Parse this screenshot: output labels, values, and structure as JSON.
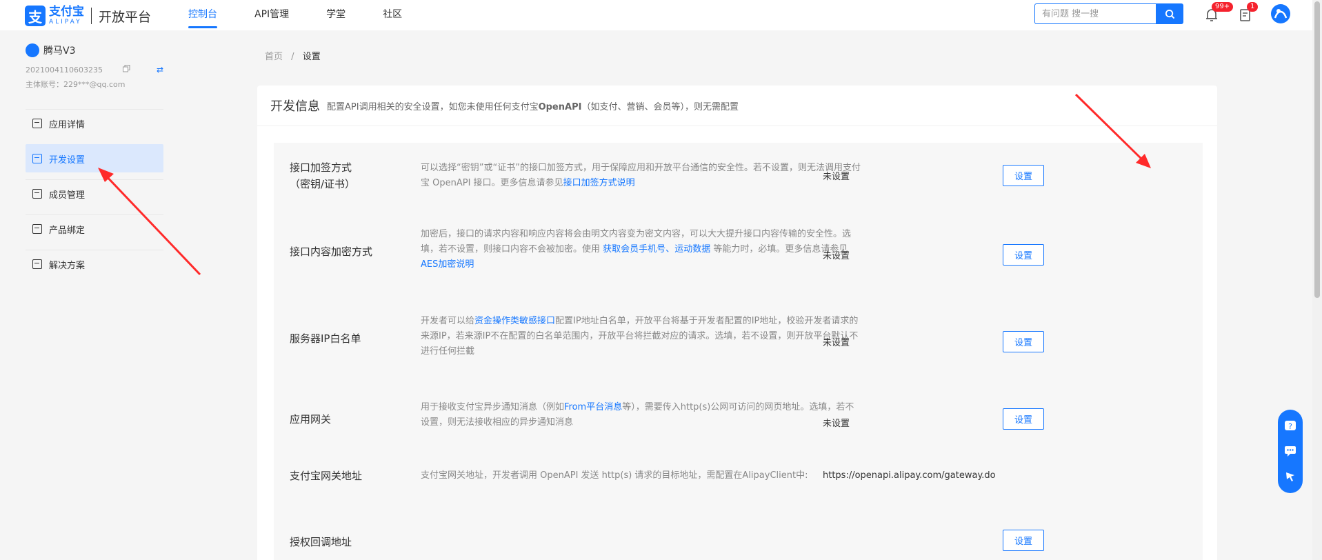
{
  "header": {
    "logo_cn": "支付宝",
    "logo_en": "ALIPAY",
    "logo_mark": "支",
    "platform": "开放平台",
    "nav": [
      {
        "label": "控制台",
        "active": true
      },
      {
        "label": "API管理",
        "active": false
      },
      {
        "label": "学堂",
        "active": false
      },
      {
        "label": "社区",
        "active": false
      }
    ],
    "search_placeholder": "有问题 搜一搜",
    "notification_badge": "99+",
    "todo_badge": "1"
  },
  "sidebar": {
    "app_name": "腾马V3",
    "app_id": "2021004110603235",
    "account": "主体账号：229***@qq.com",
    "menu": [
      {
        "label": "应用详情",
        "active": false
      },
      {
        "label": "开发设置",
        "active": true
      },
      {
        "label": "成员管理",
        "active": false
      },
      {
        "label": "产品绑定",
        "active": false
      },
      {
        "label": "解决方案",
        "active": false
      }
    ]
  },
  "breadcrumb": {
    "home": "首页",
    "separator": "/",
    "current": "设置"
  },
  "card": {
    "title": "开发信息",
    "desc_pre": "配置API调用相关的安全设置，如您未使用任何支付宝",
    "desc_bold": "OpenAPI",
    "desc_post": "（如支付、营销、会员等），则无需配置"
  },
  "rows": [
    {
      "label_line1": "接口加签方式",
      "label_line2": "（密钥/证书）",
      "desc_a": "可以选择“密钥”或“证书”的接口加签方式，用于保障应用和开放平台通信的安全性。若不设置，则无法调用支付宝 OpenAPI 接口。更多信息请参见",
      "desc_link": "接口加签方式说明",
      "status": "未设置",
      "button": "设置"
    },
    {
      "label": "接口内容加密方式",
      "desc_a": "加密后，接口的请求内容和响应内容将会由明文内容变为密文内容，可以大大提升接口内容传输的安全性。选填，若不设置，则接口内容不会被加密。使用",
      "desc_link1": "获取会员手机号",
      "desc_sep": "、",
      "desc_link2": "运动数据",
      "desc_b": "等能力时，必填。更多信息请参见",
      "desc_link3": "AES加密说明",
      "status": "未设置",
      "button": "设置"
    },
    {
      "label": "服务器IP白名单",
      "desc_a": "开发者可以给",
      "desc_link": "资金操作类敏感接口",
      "desc_b": "配置IP地址白名单，开放平台将基于开发者配置的IP地址，校验开发者请求的来源IP，若来源IP不在配置的白名单范围内，开放平台将拦截对应的请求。选填，若不设置，则开放平台默认不进行任何拦截",
      "status": "未设置",
      "button": "设置"
    },
    {
      "label": "应用网关",
      "desc_a": "用于接收支付宝异步通知消息（例如",
      "desc_link": "From平台消息",
      "desc_b": "等），需要传入http(s)公网可访问的网页地址。选填，若不设置，则无法接收相应的异步通知消息",
      "status": "未设置",
      "button": "设置"
    },
    {
      "label": "支付宝网关地址",
      "desc_a": "支付宝网关地址，开发者调用 OpenAPI 发送 http(s) 请求的目标地址，需配置在AlipayClient中:",
      "status": "https://openapi.alipay.com/gateway.do"
    },
    {
      "label": "授权回调地址",
      "button": "设置"
    }
  ],
  "colors": {
    "accent": "#1677ff",
    "annotation": "#ff2a2a"
  }
}
